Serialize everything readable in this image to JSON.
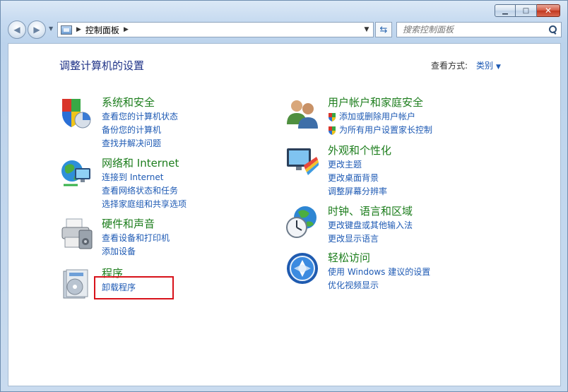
{
  "address": {
    "segment": "控制面板"
  },
  "search": {
    "placeholder": "搜索控制面板"
  },
  "page": {
    "title": "调整计算机的设置",
    "view_by_label": "查看方式:",
    "view_by_value": "类别"
  },
  "categories": [
    {
      "title": "系统和安全",
      "icon": "shield-pie-icon",
      "links": [
        "查看您的计算机状态",
        "备份您的计算机",
        "查找并解决问题"
      ]
    },
    {
      "title": "网络和 Internet",
      "icon": "globe-monitor-icon",
      "links": [
        "连接到 Internet",
        "查看网络状态和任务",
        "选择家庭组和共享选项"
      ]
    },
    {
      "title": "硬件和声音",
      "icon": "printer-icon",
      "links": [
        "查看设备和打印机",
        "添加设备"
      ]
    },
    {
      "title": "程序",
      "icon": "program-disc-icon",
      "links": [
        "卸载程序"
      ]
    },
    {
      "title": "用户帐户和家庭安全",
      "icon": "users-icon",
      "links": [
        "添加或删除用户帐户",
        "为所有用户设置家长控制"
      ]
    },
    {
      "title": "外观和个性化",
      "icon": "monitor-palette-icon",
      "links": [
        "更改主题",
        "更改桌面背景",
        "调整屏幕分辨率"
      ]
    },
    {
      "title": "时钟、语言和区域",
      "icon": "clock-globe-icon",
      "links": [
        "更改键盘或其他输入法",
        "更改显示语言"
      ]
    },
    {
      "title": "轻松访问",
      "icon": "ease-of-access-icon",
      "links": [
        "使用 Windows 建议的设置",
        "优化视频显示"
      ]
    }
  ]
}
